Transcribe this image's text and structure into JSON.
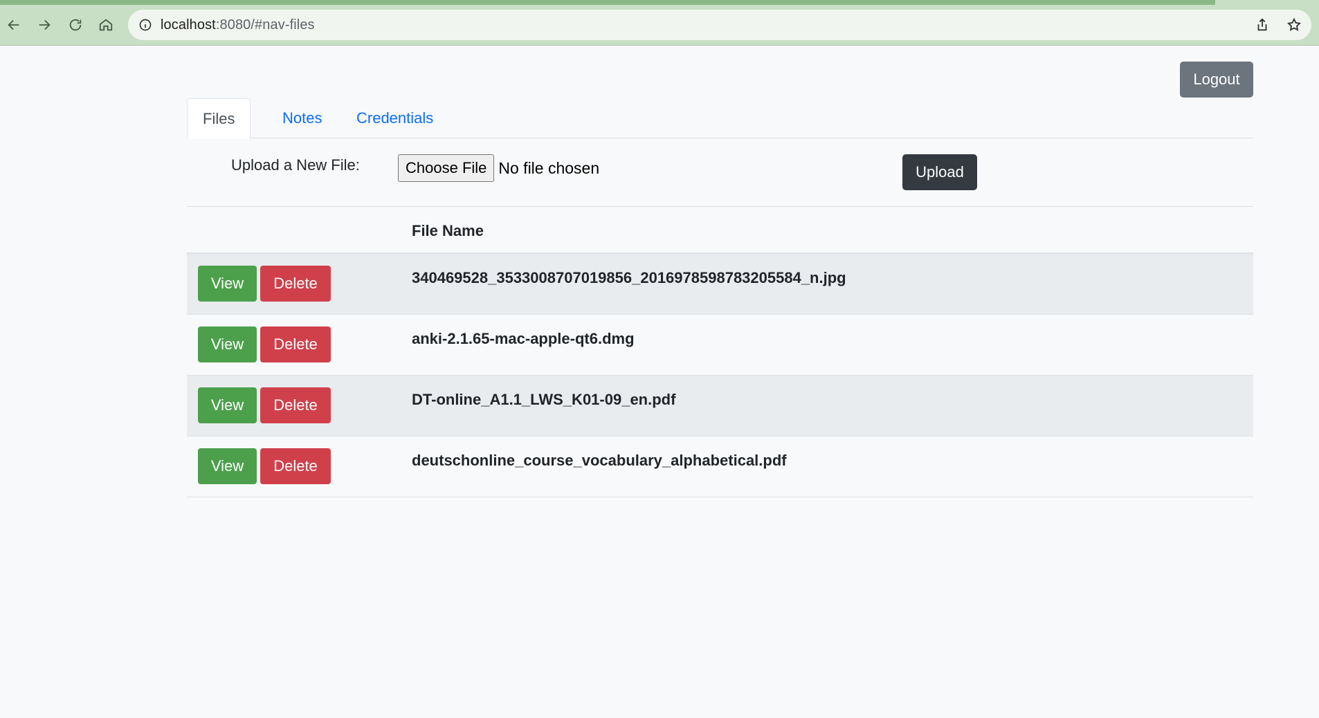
{
  "browser": {
    "url_host": "localhost",
    "url_rest": ":8080/#nav-files"
  },
  "header": {
    "logout_label": "Logout"
  },
  "tabs": [
    {
      "label": "Files",
      "active": true
    },
    {
      "label": "Notes",
      "active": false
    },
    {
      "label": "Credentials",
      "active": false
    }
  ],
  "upload": {
    "label": "Upload a New File:",
    "choose_label": "Choose File",
    "status": "No file chosen",
    "upload_label": "Upload"
  },
  "table": {
    "header_name": "File Name",
    "view_label": "View",
    "delete_label": "Delete",
    "rows": [
      {
        "name": "340469528_3533008707019856_2016978598783205584_n.jpg"
      },
      {
        "name": "anki-2.1.65-mac-apple-qt6.dmg"
      },
      {
        "name": "DT-online_A1.1_LWS_K01-09_en.pdf"
      },
      {
        "name": "deutschonline_course_vocabulary_alphabetical.pdf"
      }
    ]
  },
  "colors": {
    "view": "#4ca04c",
    "delete": "#d0404b",
    "logout": "#6c757d",
    "upload": "#343a40",
    "tab_link": "#0d6efd"
  }
}
